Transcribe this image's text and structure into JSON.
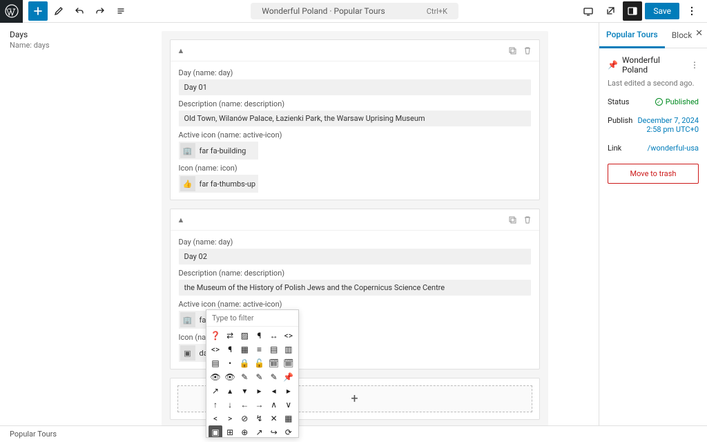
{
  "topbar": {
    "doc_title": "Wonderful Poland · Popular Tours",
    "shortcut": "Ctrl+K",
    "save_label": "Save"
  },
  "left_panel": {
    "title": "Days",
    "subtitle": "Name: days"
  },
  "cards": [
    {
      "collapse_glyph": "▲",
      "fields": {
        "day_label": "Day (name: day)",
        "day_value": "Day 01",
        "desc_label": "Description (name: description)",
        "desc_value": "Old Town, Wilanów Palace, Łazienki Park, the Warsaw Uprising Museum",
        "active_icon_label": "Active icon (name: active-icon)",
        "active_icon_value": "far fa-building",
        "icon_label": "Icon (name: icon)",
        "icon_value": "far fa-thumbs-up"
      }
    },
    {
      "collapse_glyph": "▲",
      "fields": {
        "day_label": "Day (name: day)",
        "day_value": "Day 02",
        "desc_label": "Description (name: description)",
        "desc_value": "the Museum of the History of Polish Jews and the Copernicus Science Centre",
        "active_icon_label": "Active icon (name: active-icon)",
        "active_icon_value": "far fa-building",
        "icon_label": "Icon (name: icon)",
        "icon_value": "dashicons dashicons-excerpt-vi"
      }
    }
  ],
  "picker": {
    "filter_placeholder": "Type to filter",
    "icons": [
      "❓",
      "⇄",
      "▨",
      "¶",
      "↔",
      "<>",
      "<>",
      "¶",
      "▦",
      "≡",
      "▤",
      "▥",
      "▤",
      "•",
      "🔒",
      "🔓",
      "🗓",
      "🗓",
      "👁",
      "👁",
      "✎",
      "✎",
      "✎",
      "📌",
      "↗",
      "▴",
      "▾",
      "▸",
      "◂",
      "▸",
      "↑",
      "↓",
      "←",
      "→",
      "∧",
      "∨",
      "<",
      ">",
      "⊘",
      "↯",
      "✕",
      "▦",
      "▣",
      "⊞",
      "⊕",
      "↗",
      "↪",
      "⟳"
    ],
    "selected_index": 42
  },
  "sidebar": {
    "tabs": [
      "Popular Tours",
      "Block"
    ],
    "post_title": "Wonderful Poland",
    "last_edited": "Last edited a second ago.",
    "status_label": "Status",
    "status_value": "Published",
    "publish_label": "Publish",
    "publish_value_line1": "December 7, 2024",
    "publish_value_line2": "2:58 pm UTC+0",
    "link_label": "Link",
    "link_value": "/wonderful-usa",
    "trash_label": "Move to trash"
  },
  "breadcrumb": "Popular Tours"
}
